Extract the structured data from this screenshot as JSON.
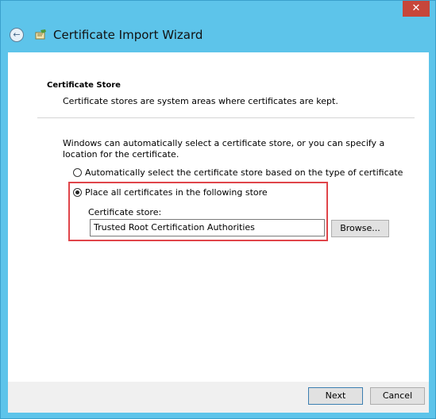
{
  "window": {
    "close_glyph": "✕"
  },
  "header": {
    "title": "Certificate Import Wizard",
    "back_icon": "back-arrow-icon",
    "app_icon": "certificate-wizard-icon"
  },
  "section": {
    "title": "Certificate Store",
    "description": "Certificate stores are system areas where certificates are kept."
  },
  "intro": "Windows can automatically select a certificate store, or you can specify a location for the certificate.",
  "options": [
    {
      "label": "Automatically select the certificate store based on the type of certificate",
      "checked": false
    },
    {
      "label": "Place all certificates in the following store",
      "checked": true
    }
  ],
  "store": {
    "label": "Certificate store:",
    "value": "Trusted Root Certification Authorities",
    "browse_label": "Browse..."
  },
  "footer": {
    "next_label": "Next",
    "cancel_label": "Cancel"
  },
  "colors": {
    "titlebar": "#5dc4ea",
    "close": "#c7463a",
    "highlight": "#e0454a"
  }
}
